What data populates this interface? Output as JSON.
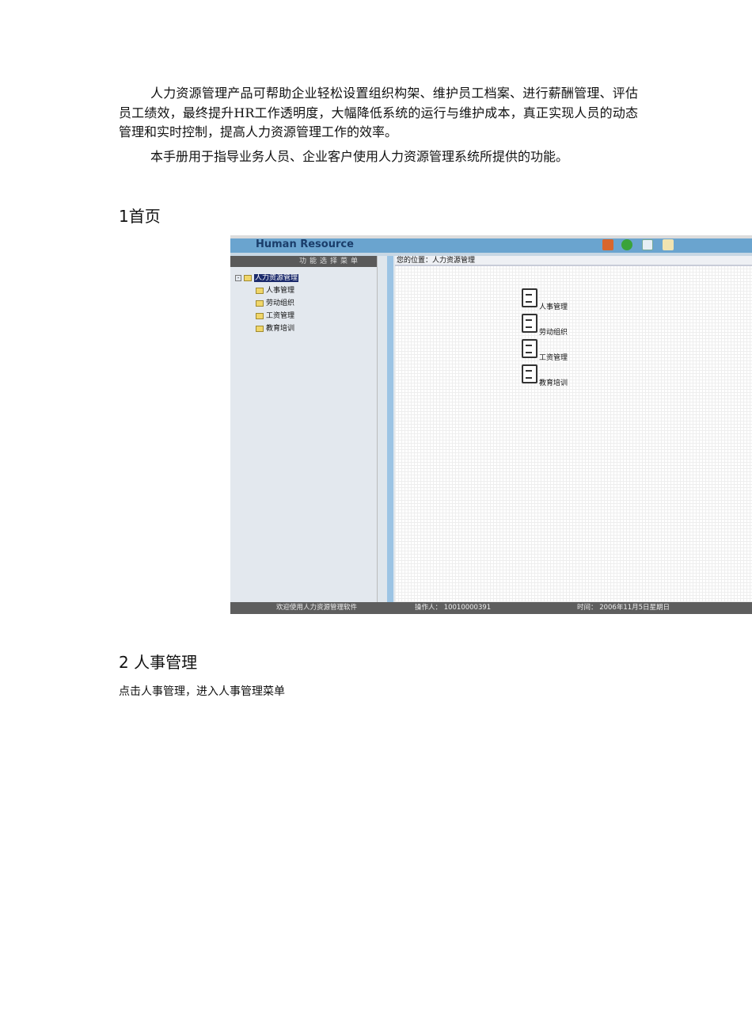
{
  "intro": {
    "p1": "人力资源管理产品可帮助企业轻松设置组织构架、维护员工档案、进行薪酬管理、评估员工绩效，最终提升HR工作透明度，大幅降低系统的运行与维护成本，真正实现人员的动态管理和实时控制，提高人力资源管理工作的效率。",
    "p2": "本手册用于指导业务人员、企业客户使用人力资源管理系统所提供的功能。"
  },
  "section1": {
    "title": "1首页"
  },
  "app": {
    "logo": "Human Resource",
    "menu_title": "功能选择菜单",
    "location": "您的位置：人力资源管理",
    "tree": {
      "root": "人力资源管理",
      "children": [
        "人事管理",
        "劳动组织",
        "工资管理",
        "教育培训"
      ]
    },
    "modules": [
      "人事管理",
      "劳动组织",
      "工资管理",
      "教育培训"
    ],
    "status": {
      "welcome": "欢迎使用人力资源管理软件",
      "operator": "操作人： 10010000391",
      "time": "时间： 2006年11月5日星期日"
    }
  },
  "section2": {
    "title": "2 人事管理",
    "desc": "点击人事管理，进入人事管理菜单"
  }
}
